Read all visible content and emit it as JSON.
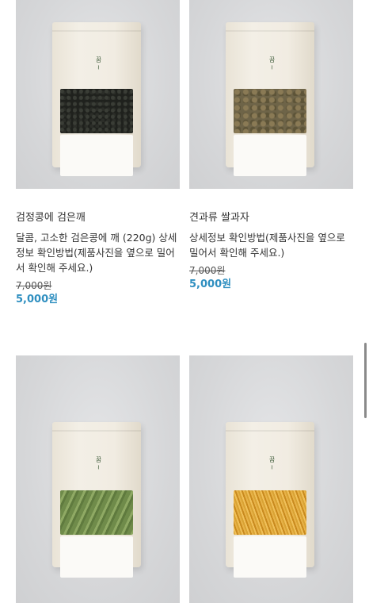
{
  "products": [
    {
      "name": "검정콩에 검은깨",
      "description": "달콤, 고소한 검은콩에 깨 (220g) 상세정보 확인방법(제품사진을 옆으로 밀어서 확인해 주세요.)",
      "original_price": "7,000원",
      "sale_price": "5,000원",
      "fill": "black"
    },
    {
      "name": "견과류 쌀과자",
      "description": "상세정보 확인방법(제품사진을 옆으로 밀어서 확인해 주세요.)",
      "original_price": "7,000원",
      "sale_price": "5,000원",
      "fill": "nuts"
    },
    {
      "name": "",
      "description": "",
      "original_price": "",
      "sale_price": "",
      "fill": "green"
    },
    {
      "name": "",
      "description": "",
      "original_price": "",
      "sale_price": "",
      "fill": "orange"
    }
  ],
  "colors": {
    "price": "#2f8fc0",
    "text": "#333333"
  }
}
